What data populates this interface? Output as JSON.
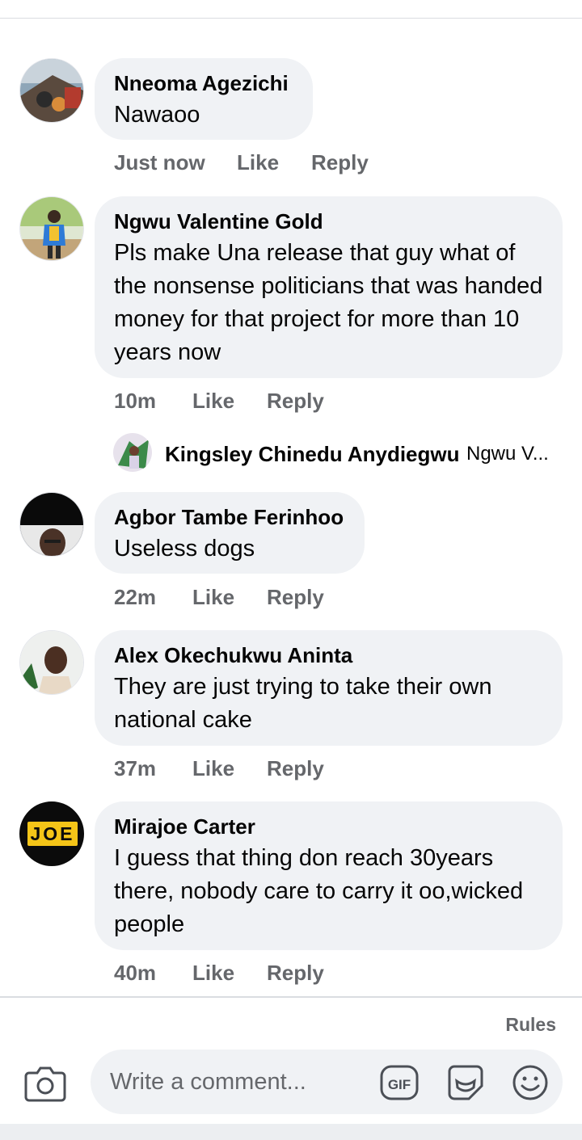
{
  "comments": [
    {
      "author": "Nneoma Agezichi",
      "text": "Nawaoo",
      "time": "Just now",
      "like": "Like",
      "reply": "Reply"
    },
    {
      "author": "Ngwu Valentine Gold",
      "text": "Pls make Una release that guy what of the nonsense politicians that was handed money for that project for more than 10 years now",
      "time": "10m",
      "like": "Like",
      "reply": "Reply"
    },
    {
      "author": "Agbor Tambe Ferinhoo",
      "text": "Useless dogs",
      "time": "22m",
      "like": "Like",
      "reply": "Reply"
    },
    {
      "author": "Alex Okechukwu Aninta",
      "text": "They are just trying to take their own national cake",
      "time": "37m",
      "like": "Like",
      "reply": "Reply"
    },
    {
      "author": "Mirajoe Carter",
      "text": "I guess that thing don reach 30years there, nobody care to carry it oo,wicked people",
      "time": "40m",
      "like": "Like",
      "reply": "Reply"
    }
  ],
  "reply_thread": {
    "author": "Kingsley Chinedu Anydiegwu",
    "preview": "Ngwu V..."
  },
  "avatar_labels": {
    "joe": "JOE"
  },
  "composer": {
    "rules": "Rules",
    "placeholder": "Write a comment...",
    "gif": "GIF"
  },
  "icons": [
    "camera-icon",
    "gif-icon",
    "sticker-icon",
    "emoji-icon"
  ],
  "colors": {
    "bubble": "#f0f2f5",
    "meta": "#65676b",
    "joe_badge": "#f5c518"
  }
}
